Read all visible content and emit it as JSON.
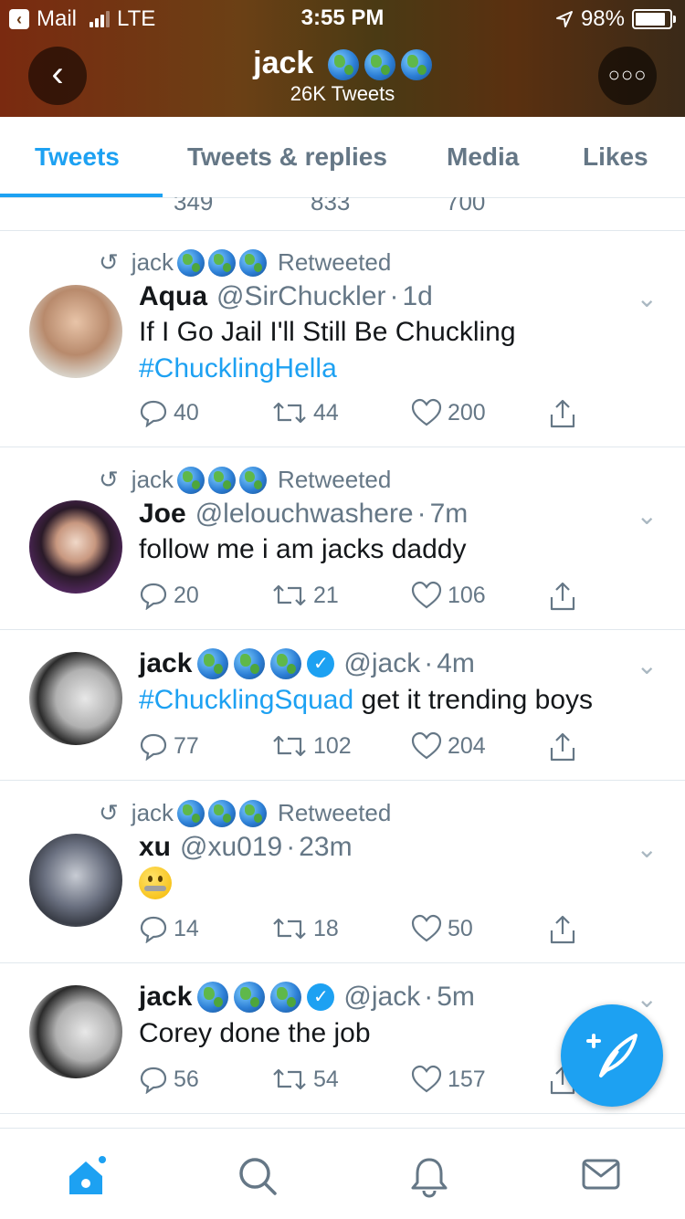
{
  "status_bar": {
    "carrier_back": "Mail",
    "network": "LTE",
    "time": "3:55 PM",
    "battery": "98%"
  },
  "header": {
    "title": "jack",
    "subtitle": "26K Tweets"
  },
  "tabs": [
    {
      "label": "Tweets",
      "active": true
    },
    {
      "label": "Tweets & replies",
      "active": false
    },
    {
      "label": "Media",
      "active": false
    },
    {
      "label": "Likes",
      "active": false
    }
  ],
  "partial_row": {
    "replies": "349",
    "retweets": "833",
    "likes": "700"
  },
  "tweets": [
    {
      "retweeted_by": "jack",
      "retweet_label": "Retweeted",
      "name": "Aqua",
      "handle": "@SirChuckler",
      "time": "1d",
      "text_line1": "If I Go Jail I'll Still Be Chuckling",
      "text_line2": "#ChucklingHella",
      "replies": "40",
      "retweets": "44",
      "likes": "200"
    },
    {
      "retweeted_by": "jack",
      "retweet_label": "Retweeted",
      "name": "Joe",
      "handle": "@lelouchwashere",
      "time": "7m",
      "text_line1": "follow me i am jacks daddy",
      "replies": "20",
      "retweets": "21",
      "likes": "106"
    },
    {
      "name": "jack",
      "handle": "@jack",
      "time": "4m",
      "hashtag": "#ChucklingSquad",
      "text_rest": " get it trending boys",
      "replies": "77",
      "retweets": "102",
      "likes": "204"
    },
    {
      "retweeted_by": "jack",
      "retweet_label": "Retweeted",
      "name": "xu",
      "handle": "@xu019",
      "time": "23m",
      "emoji": "zipper-mouth-face",
      "replies": "14",
      "retweets": "18",
      "likes": "50"
    },
    {
      "name": "jack",
      "handle": "@jack",
      "time": "5m",
      "text_line1": "Corey done the job",
      "replies": "56",
      "retweets": "54",
      "likes": "157"
    }
  ],
  "icons": {
    "reply": "reply-icon",
    "retweet": "retweet-icon",
    "like": "heart-icon",
    "share": "share-icon",
    "compose": "compose-tweet-icon",
    "home": "home-icon",
    "search": "search-icon",
    "notifications": "bell-icon",
    "messages": "mail-icon",
    "globe": "globe-emoji-icon"
  },
  "colors": {
    "accent": "#1da1f2",
    "text": "#14171a",
    "muted": "#657786",
    "divider": "#e1e8ed"
  }
}
